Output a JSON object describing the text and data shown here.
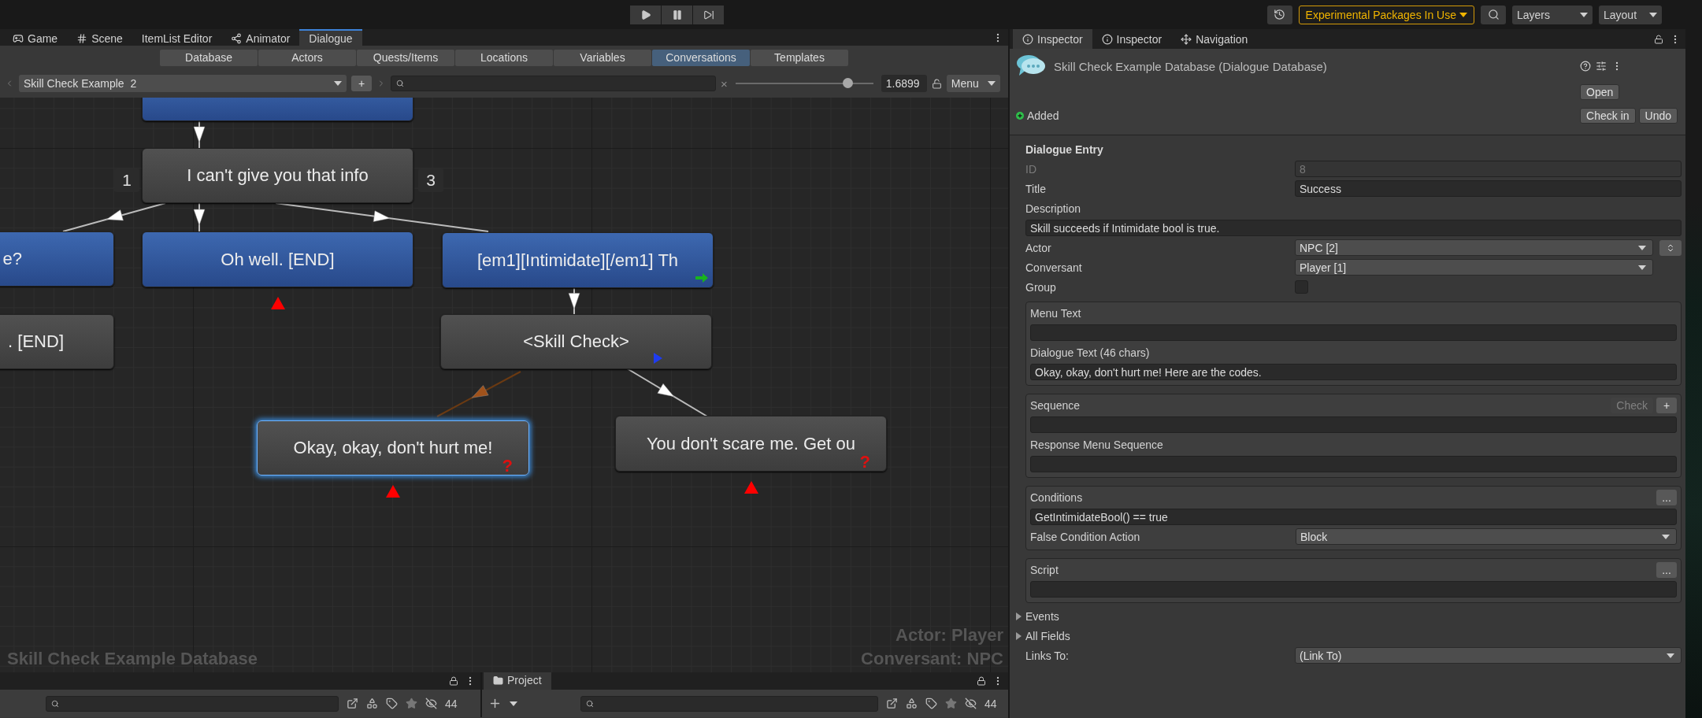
{
  "toolbar": {
    "experimental": "Experimental Packages In Use",
    "layers": "Layers",
    "layout": "Layout"
  },
  "editor_tabs": [
    {
      "label": "Game",
      "selected": false
    },
    {
      "label": "Scene",
      "selected": false
    },
    {
      "label": "ItemList Editor",
      "selected": false
    },
    {
      "label": "Animator",
      "selected": false
    },
    {
      "label": "Dialogue",
      "selected": true
    }
  ],
  "dialogue_toolbar": {
    "sections": [
      {
        "label": "Database",
        "selected": false
      },
      {
        "label": "Actors",
        "selected": false
      },
      {
        "label": "Quests/Items",
        "selected": false
      },
      {
        "label": "Locations",
        "selected": false
      },
      {
        "label": "Variables",
        "selected": false
      },
      {
        "label": "Conversations",
        "selected": true
      },
      {
        "label": "Templates",
        "selected": false
      }
    ],
    "add": "+",
    "conversation": "Skill Check Example  2",
    "clear": "×",
    "zoom": {
      "level": 0.81
    },
    "zoom_value": "1.6899",
    "menu": "Menu"
  },
  "canvas": {
    "nodes": [
      {
        "kind": "player",
        "selected": false
      },
      {
        "kind": "npc",
        "title": "I can't give you that info",
        "selected": false
      },
      {
        "kind": "player",
        "title": "e?",
        "selected": false
      },
      {
        "kind": "player",
        "title": "Oh well. [END]",
        "selected": false,
        "dead_end": true
      },
      {
        "kind": "npc",
        "title": ". [END]",
        "selected": false
      },
      {
        "kind": "player",
        "title": "[em1][Intimidate][/em1] Th",
        "selected": false,
        "cross_link": true
      },
      {
        "kind": "npc",
        "title": "<Skill Check>",
        "selected": false,
        "has_sequence": true
      },
      {
        "kind": "npc",
        "title": "Okay, okay, don't hurt me!",
        "selected": true,
        "dead_end": true,
        "condition_mark": "?"
      },
      {
        "kind": "npc",
        "title": "You don't scare me. Get ou",
        "selected": false,
        "dead_end": true,
        "condition_mark": "?"
      }
    ],
    "branch_labels": [
      "1",
      "3"
    ],
    "database_name": "Skill Check Example Database",
    "actor": "Actor: Player",
    "conversant": "Conversant: NPC"
  },
  "hierarchy_panel": {
    "count": "44"
  },
  "project_panel": {
    "tab": "Project",
    "count": "44"
  },
  "inspector": {
    "tabs": [
      {
        "label": "Inspector",
        "selected": true
      },
      {
        "label": "Inspector",
        "selected": false
      },
      {
        "label": "Navigation",
        "selected": false
      }
    ],
    "asset_title": "Skill Check Example Database (Dialogue Database)",
    "open": "Open",
    "status": "Added",
    "check_in": "Check in",
    "undo": "Undo",
    "section": "Dialogue Entry",
    "rows": [
      {
        "kind": "field",
        "label": "ID",
        "value": "8",
        "disabled": true
      },
      {
        "kind": "field",
        "label": "Title",
        "value": "Success",
        "disabled": false
      },
      {
        "kind": "caption",
        "label": "Description"
      },
      {
        "kind": "wide_field",
        "value": "Skill succeeds if Intimidate bool is true."
      },
      {
        "kind": "dropdown",
        "label": "Actor",
        "value": "NPC [2]",
        "spinner": true
      },
      {
        "kind": "dropdown",
        "label": "Conversant",
        "value": "Player [1]"
      },
      {
        "kind": "checkbox",
        "label": "Group",
        "checked": false
      },
      {
        "kind": "group",
        "rows": [
          {
            "kind": "caption",
            "label": "Menu Text"
          },
          {
            "kind": "wide_field"
          },
          {
            "kind": "caption",
            "label": "Dialogue Text (46 chars)"
          },
          {
            "kind": "wide_field",
            "value": "Okay, okay, don't hurt me! Here are the codes."
          }
        ]
      },
      {
        "kind": "group",
        "rows": [
          {
            "kind": "caption",
            "label": "Sequence",
            "buttons": [
              {
                "label": "Check",
                "disabled": true
              },
              {
                "label": "+",
                "disabled": false
              }
            ]
          },
          {
            "kind": "wide_field"
          },
          {
            "kind": "caption",
            "label": "Response Menu Sequence"
          },
          {
            "kind": "wide_field"
          }
        ]
      },
      {
        "kind": "group",
        "rows": [
          {
            "kind": "caption",
            "label": "Conditions",
            "buttons": [
              {
                "label": "...",
                "disabled": false
              }
            ]
          },
          {
            "kind": "wide_field",
            "value": "GetIntimidateBool()  == true"
          },
          {
            "kind": "group_dropdown",
            "label": "False Condition Action",
            "value": "Block"
          }
        ]
      },
      {
        "kind": "group",
        "rows": [
          {
            "kind": "caption",
            "label": "Script",
            "buttons": [
              {
                "label": "...",
                "disabled": false
              }
            ]
          },
          {
            "kind": "wide_field"
          }
        ]
      },
      {
        "kind": "foldout",
        "label": "Events",
        "expanded": false
      },
      {
        "kind": "foldout",
        "label": "All Fields",
        "expanded": false
      },
      {
        "kind": "wide_dropdown",
        "label": "Links To:",
        "value": "(Link To)"
      }
    ]
  }
}
